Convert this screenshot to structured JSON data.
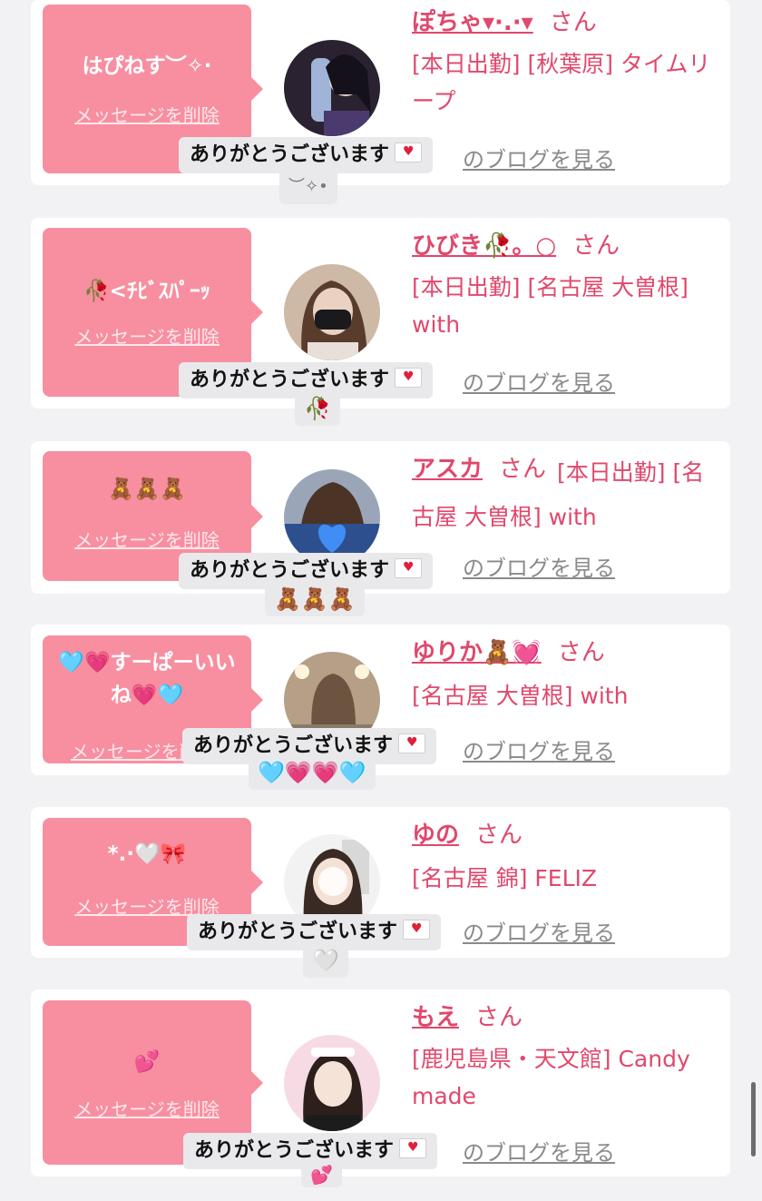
{
  "messages": [
    {
      "bubble": "はぴねす︶✧·",
      "delete_label": "メッセージを削除",
      "name": "ぽちゃ▾·.·▾",
      "honorific": "さん",
      "shop": "[本日出勤] [秋葉原] タイムリープ",
      "blog_label": "のブログを見る",
      "thanks_label": "ありがとうございます",
      "thanks_emoji": "︶✧•"
    },
    {
      "bubble": "🥀<ﾁﾋﾞｽﾊﾟｰｯ",
      "delete_label": "メッセージを削除",
      "name": "ひびき🥀。○",
      "honorific": "さん",
      "shop": "[本日出勤] [名古屋 大曽根] with",
      "blog_label": "のブログを見る",
      "thanks_label": "ありがとうございます",
      "thanks_emoji": "🥀"
    },
    {
      "bubble": "🧸🧸🧸",
      "delete_label": "メッセージを削除",
      "name": "アスカ",
      "honorific": "さん",
      "shop": "[本日出勤] [名古屋 大曽根] with",
      "blog_label": "のブログを見る",
      "thanks_label": "ありがとうございます",
      "thanks_emoji": "🧸🧸🧸"
    },
    {
      "bubble": "🩵💗すーぱーいいね💗🩵",
      "delete_label": "メッセージを削除",
      "name": "ゆりか🧸💓",
      "honorific": "さん",
      "shop": "[名古屋 大曽根] with",
      "blog_label": "のブログを見る",
      "thanks_label": "ありがとうございます",
      "thanks_emoji": "🩵💗💗🩵"
    },
    {
      "bubble": "*.·🤍🎀",
      "delete_label": "メッセージを削除",
      "name": "ゆの",
      "honorific": "さん",
      "shop": "[名古屋 錦] FELIZ",
      "blog_label": "のブログを見る",
      "thanks_label": "ありがとうございます",
      "thanks_emoji": "🤍"
    },
    {
      "bubble": "💕",
      "delete_label": "メッセージを削除",
      "name": "もえ",
      "honorific": "さん",
      "shop": "[鹿児島県・天文館] Candy made",
      "blog_label": "のブログを見る",
      "thanks_label": "ありがとうございます",
      "thanks_emoji": "💕"
    }
  ],
  "colors": {
    "bubble": "#f78fa0",
    "accent": "#e0486c",
    "link_gray": "#8a8a8a",
    "page_bg": "#f2f2f4"
  }
}
